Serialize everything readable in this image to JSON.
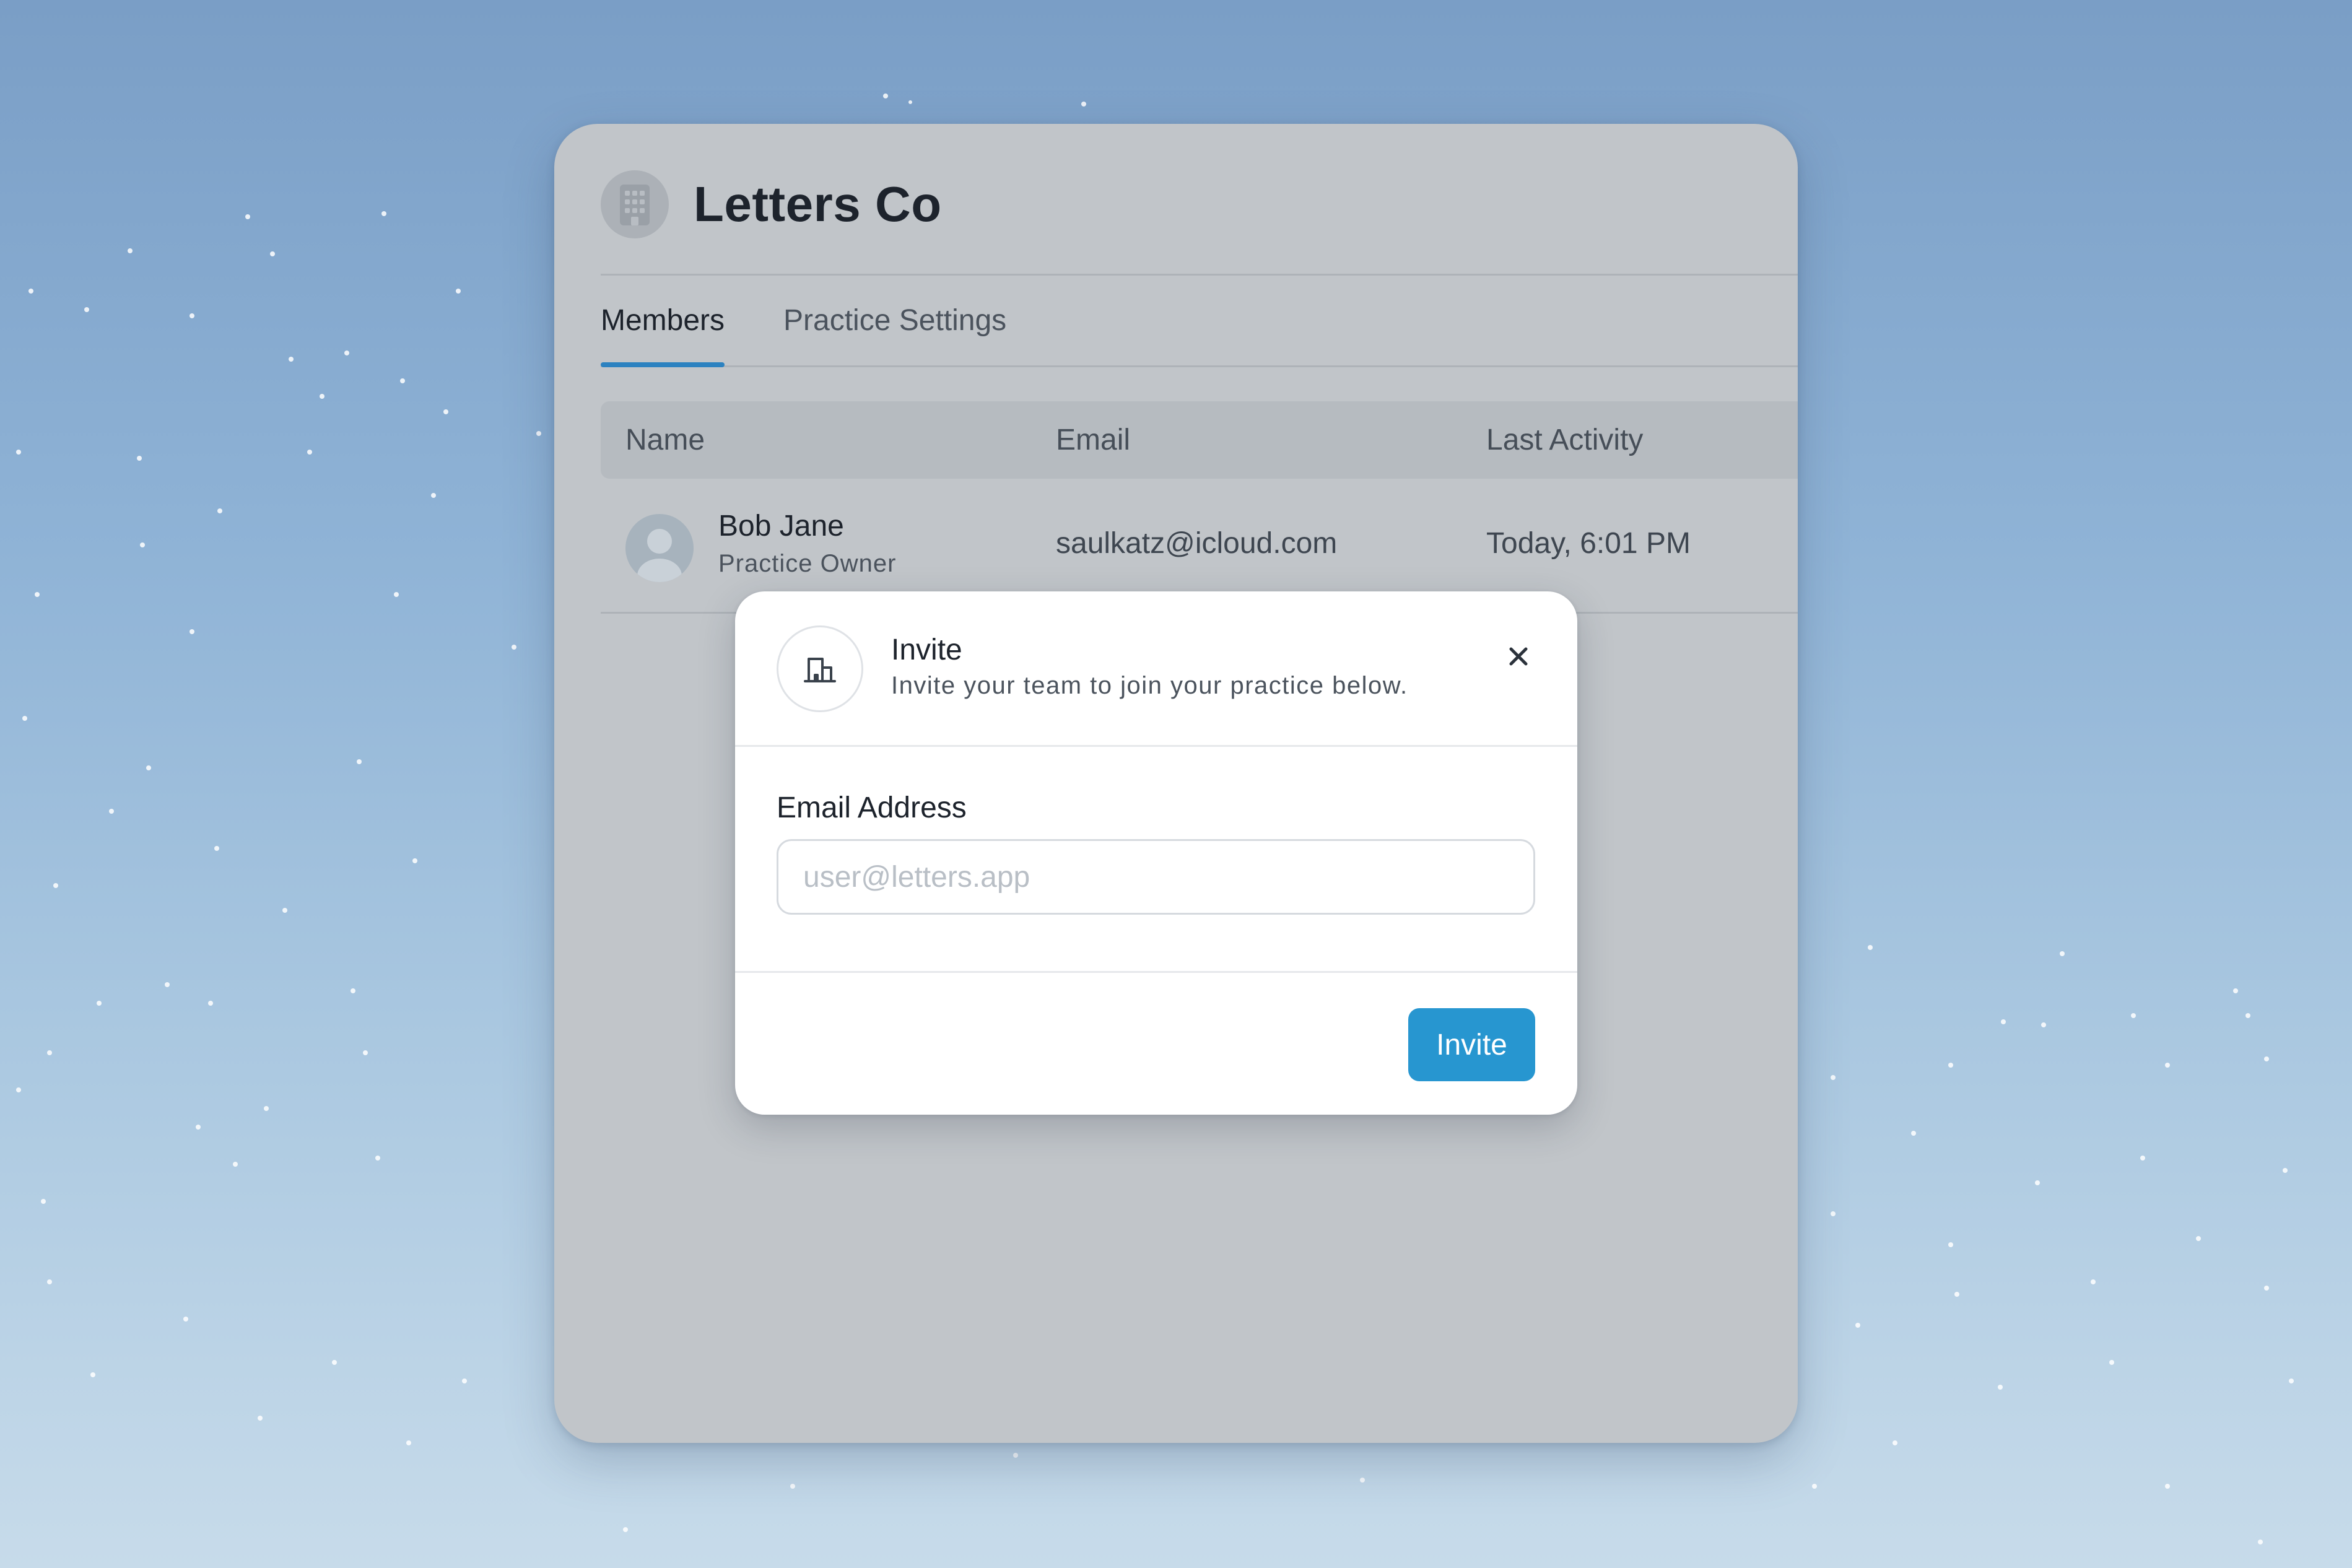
{
  "app": {
    "title": "Letters Co"
  },
  "tabs": [
    {
      "label": "Members",
      "active": true
    },
    {
      "label": "Practice Settings",
      "active": false
    }
  ],
  "table": {
    "columns": [
      "Name",
      "Email",
      "Last Activity"
    ],
    "rows": [
      {
        "name": "Bob Jane",
        "role": "Practice Owner",
        "email": "saulkatz@icloud.com",
        "last_activity": "Today, 6:01 PM"
      }
    ]
  },
  "modal": {
    "title": "Invite",
    "subtitle": "Invite your team to join your practice below.",
    "field_label": "Email Address",
    "email_value": "",
    "email_placeholder": "user@letters.app",
    "submit_label": "Invite",
    "icon": "building-icon"
  },
  "colors": {
    "accent": "#2796d0",
    "tab_underline": "#2c82c0",
    "window_bg": "#c1c5c9"
  }
}
